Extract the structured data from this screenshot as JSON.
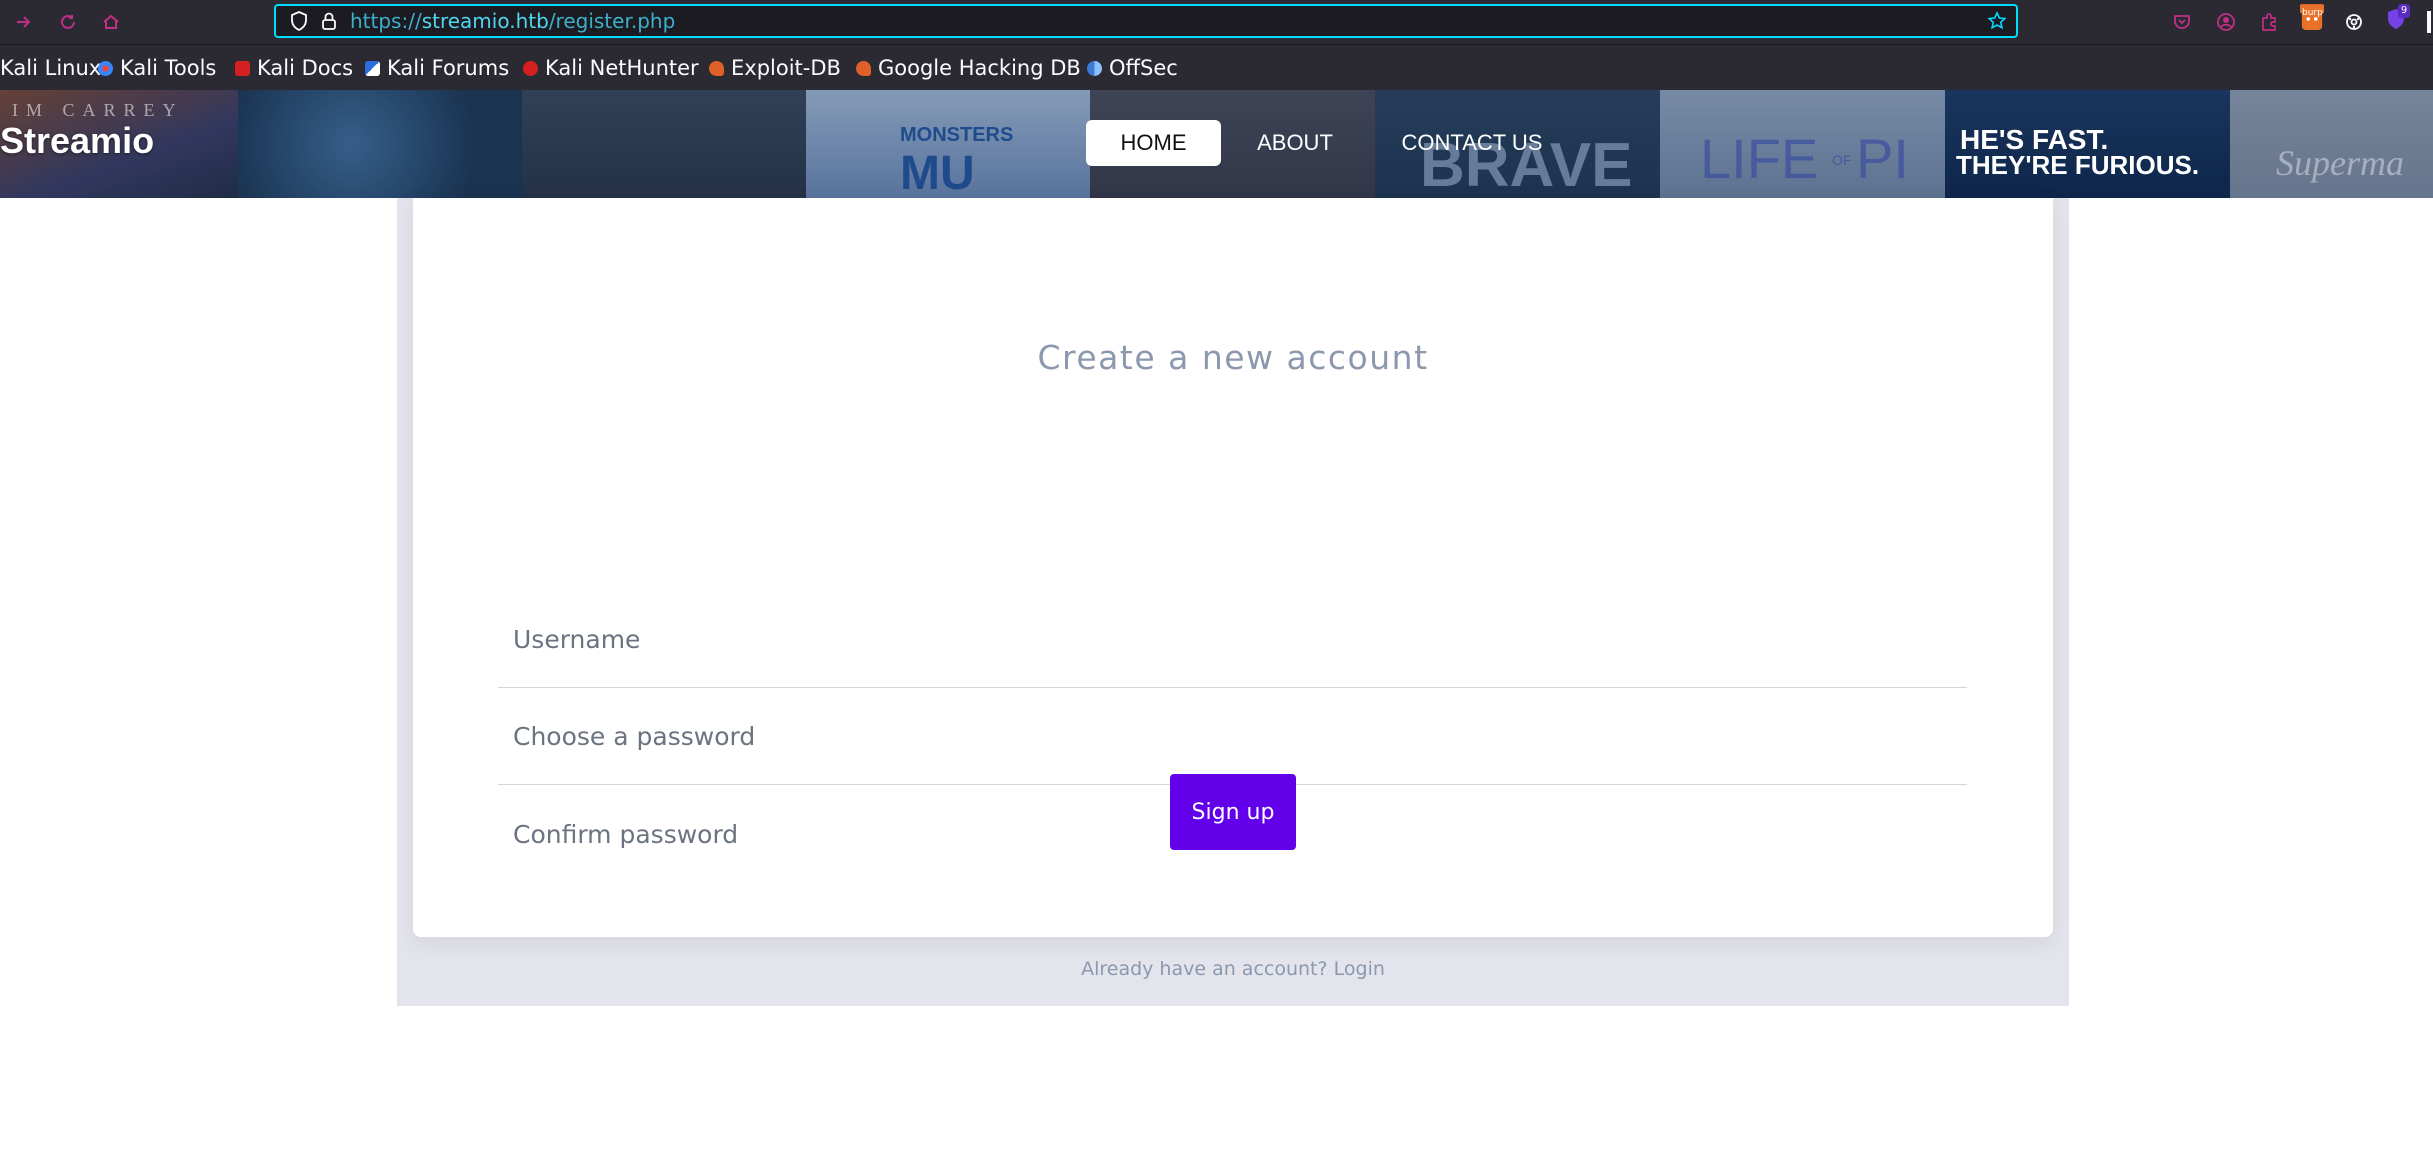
{
  "browser": {
    "url_scheme": "https://",
    "url_host": "streamio.htb",
    "url_path": "/register.php",
    "ext_badge_burp": "burp",
    "ext_badge_count": "9"
  },
  "bookmarks": [
    {
      "label": "Kali Linux",
      "icon": "kali-icon"
    },
    {
      "label": "Kali Tools",
      "icon": "kali-tools-icon"
    },
    {
      "label": "Kali Docs",
      "icon": "kali-docs-icon"
    },
    {
      "label": "Kali Forums",
      "icon": "kali-forums-icon"
    },
    {
      "label": "Kali NetHunter",
      "icon": "nethunter-icon"
    },
    {
      "label": "Exploit-DB",
      "icon": "exploit-db-icon"
    },
    {
      "label": "Google Hacking DB",
      "icon": "ghdb-icon"
    },
    {
      "label": "OffSec",
      "icon": "offsec-icon"
    }
  ],
  "site": {
    "logo": "Streamio",
    "menu": [
      "HOME",
      "ABOUT",
      "CONTACT US"
    ],
    "poster_texts": {
      "carrey": "IM CARREY",
      "monsters": "MONSTERS",
      "mu": "MU",
      "brave": "BRAVE",
      "lifeofpi_life": "LIFE",
      "lifeofpi_of": "OF",
      "lifeofpi_pi": "PI",
      "furious1": "HE'S FAST.",
      "furious2": "THEY'RE FURIOUS.",
      "superman": "Superma"
    }
  },
  "form": {
    "title": "Create a new account",
    "username_placeholder": "Username",
    "password_placeholder": "Choose a password",
    "confirm_placeholder": "Confirm password",
    "submit_label": "Sign up",
    "login_prompt": "Already have an account?",
    "login_link": "Login"
  },
  "colors": {
    "accent": "#6200ea",
    "url_border": "#00ddff",
    "toolbar_bg": "#2b2a33",
    "panel_bg": "#e4e5ec",
    "muted_text": "#8b98ad"
  }
}
